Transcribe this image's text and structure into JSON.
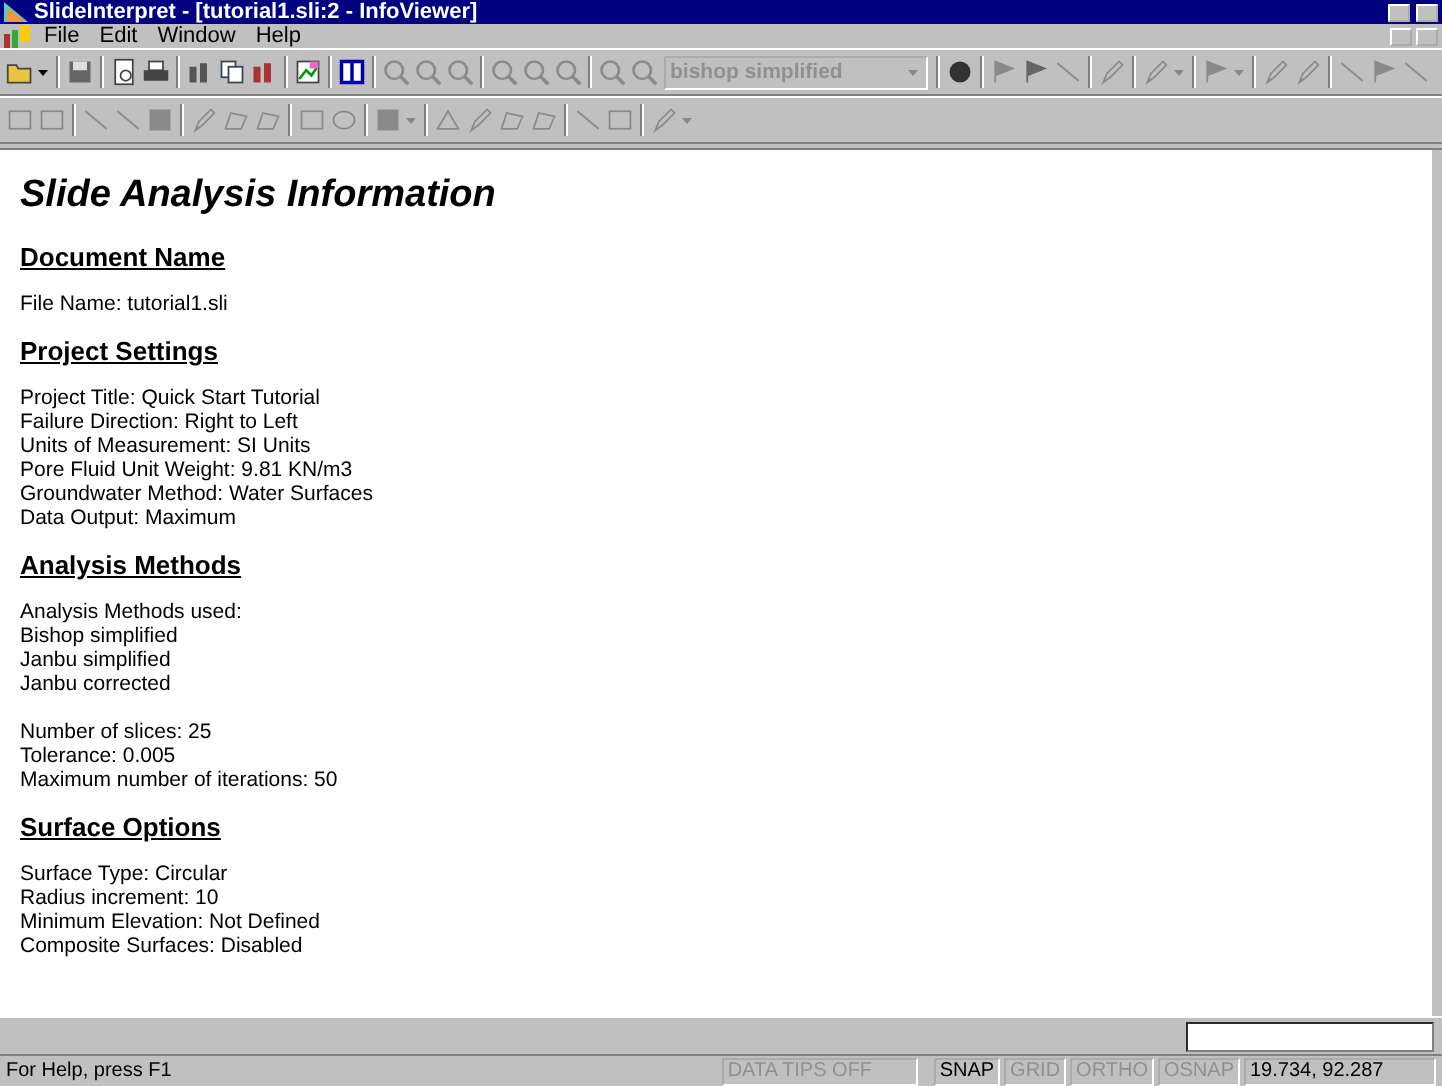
{
  "window": {
    "title": "SlideInterpret - [tutorial1.sli:2 - InfoViewer]"
  },
  "menu": [
    "File",
    "Edit",
    "Window",
    "Help"
  ],
  "toolbar": {
    "method_combo": {
      "value": "bishop simplified",
      "disabled": true
    }
  },
  "document": {
    "title": "Slide Analysis Information",
    "sections": [
      {
        "heading": "Document Name",
        "paragraphs": [
          [
            "File Name: tutorial1.sli"
          ]
        ]
      },
      {
        "heading": "Project Settings",
        "paragraphs": [
          [
            "Project Title: Quick Start Tutorial",
            "Failure Direction: Right to Left",
            "Units of Measurement: SI Units",
            "Pore Fluid Unit Weight: 9.81 KN/m3",
            "Groundwater Method: Water Surfaces",
            "Data Output: Maximum"
          ]
        ]
      },
      {
        "heading": "Analysis Methods",
        "paragraphs": [
          [
            "Analysis Methods used:",
            "Bishop simplified",
            "Janbu simplified",
            "Janbu corrected"
          ],
          [
            "Number of slices: 25",
            "Tolerance: 0.005",
            "Maximum number of iterations: 50"
          ]
        ]
      },
      {
        "heading": "Surface Options",
        "paragraphs": [
          [
            "Surface Type: Circular",
            "Radius increment: 10",
            "Minimum Elevation: Not Defined",
            "Composite Surfaces: Disabled"
          ]
        ]
      }
    ]
  },
  "status_bar": {
    "help": "For Help, press F1",
    "indicators": [
      {
        "label": "DATA TIPS OFF",
        "on": false
      },
      {
        "label": "SNAP",
        "on": true
      },
      {
        "label": "GRID",
        "on": false
      },
      {
        "label": "ORTHO",
        "on": false
      },
      {
        "label": "OSNAP",
        "on": false
      }
    ],
    "coordinates": "19.734, 92.287"
  }
}
